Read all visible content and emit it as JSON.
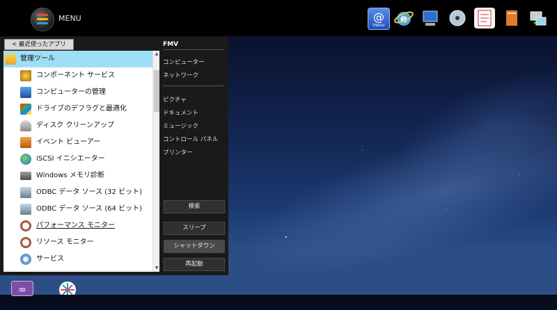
{
  "topbar": {
    "menu_label": "MENU",
    "icons": [
      {
        "name": "menu-at-icon",
        "caption": "menu"
      },
      {
        "name": "internet-explorer-icon"
      },
      {
        "name": "monitor-icon"
      },
      {
        "name": "disc-player-icon"
      },
      {
        "name": "notepad-icon"
      },
      {
        "name": "book-icon"
      },
      {
        "name": "pc-transfer-icon"
      }
    ]
  },
  "panel": {
    "recent_button": "< 最近使ったアプリ",
    "list": [
      {
        "label": "管理ツール",
        "icon": "folder-icon",
        "header": true
      },
      {
        "label": "コンポーネント サービス",
        "icon": "component-services-icon"
      },
      {
        "label": "コンピューターの管理",
        "icon": "computer-management-icon"
      },
      {
        "label": "ドライブのデフラグと最適化",
        "icon": "defrag-icon"
      },
      {
        "label": "ディスク クリーンアップ",
        "icon": "disk-cleanup-icon"
      },
      {
        "label": "イベント ビューアー",
        "icon": "event-viewer-icon"
      },
      {
        "label": "iSCSI イニシエーター",
        "icon": "iscsi-icon"
      },
      {
        "label": "Windows メモリ診断",
        "icon": "memory-diagnostic-icon"
      },
      {
        "label": "ODBC データ ソース (32 ビット)",
        "icon": "odbc-icon"
      },
      {
        "label": "ODBC データ ソース (64 ビット)",
        "icon": "odbc-icon"
      },
      {
        "label": "パフォーマンス モニター",
        "icon": "performance-monitor-icon",
        "link": true
      },
      {
        "label": "リソース モニター",
        "icon": "resource-monitor-icon"
      },
      {
        "label": "サービス",
        "icon": "services-gear-icon"
      }
    ],
    "right": {
      "heading": "FMV",
      "group1": [
        "コンピューター",
        "ネットワーク"
      ],
      "group2": [
        "ピクチャ",
        "ドキュメント",
        "ミュージック",
        "コントロール パネル",
        "プリンター"
      ]
    },
    "buttons": {
      "search": "検索",
      "sleep": "スリープ",
      "shutdown": "シャットダウン",
      "restart": "再起動"
    }
  },
  "colors": {
    "header_highlight": "#9fdff5",
    "panel_bg": "#1a1a1a",
    "topbar_bg": "#000000"
  }
}
